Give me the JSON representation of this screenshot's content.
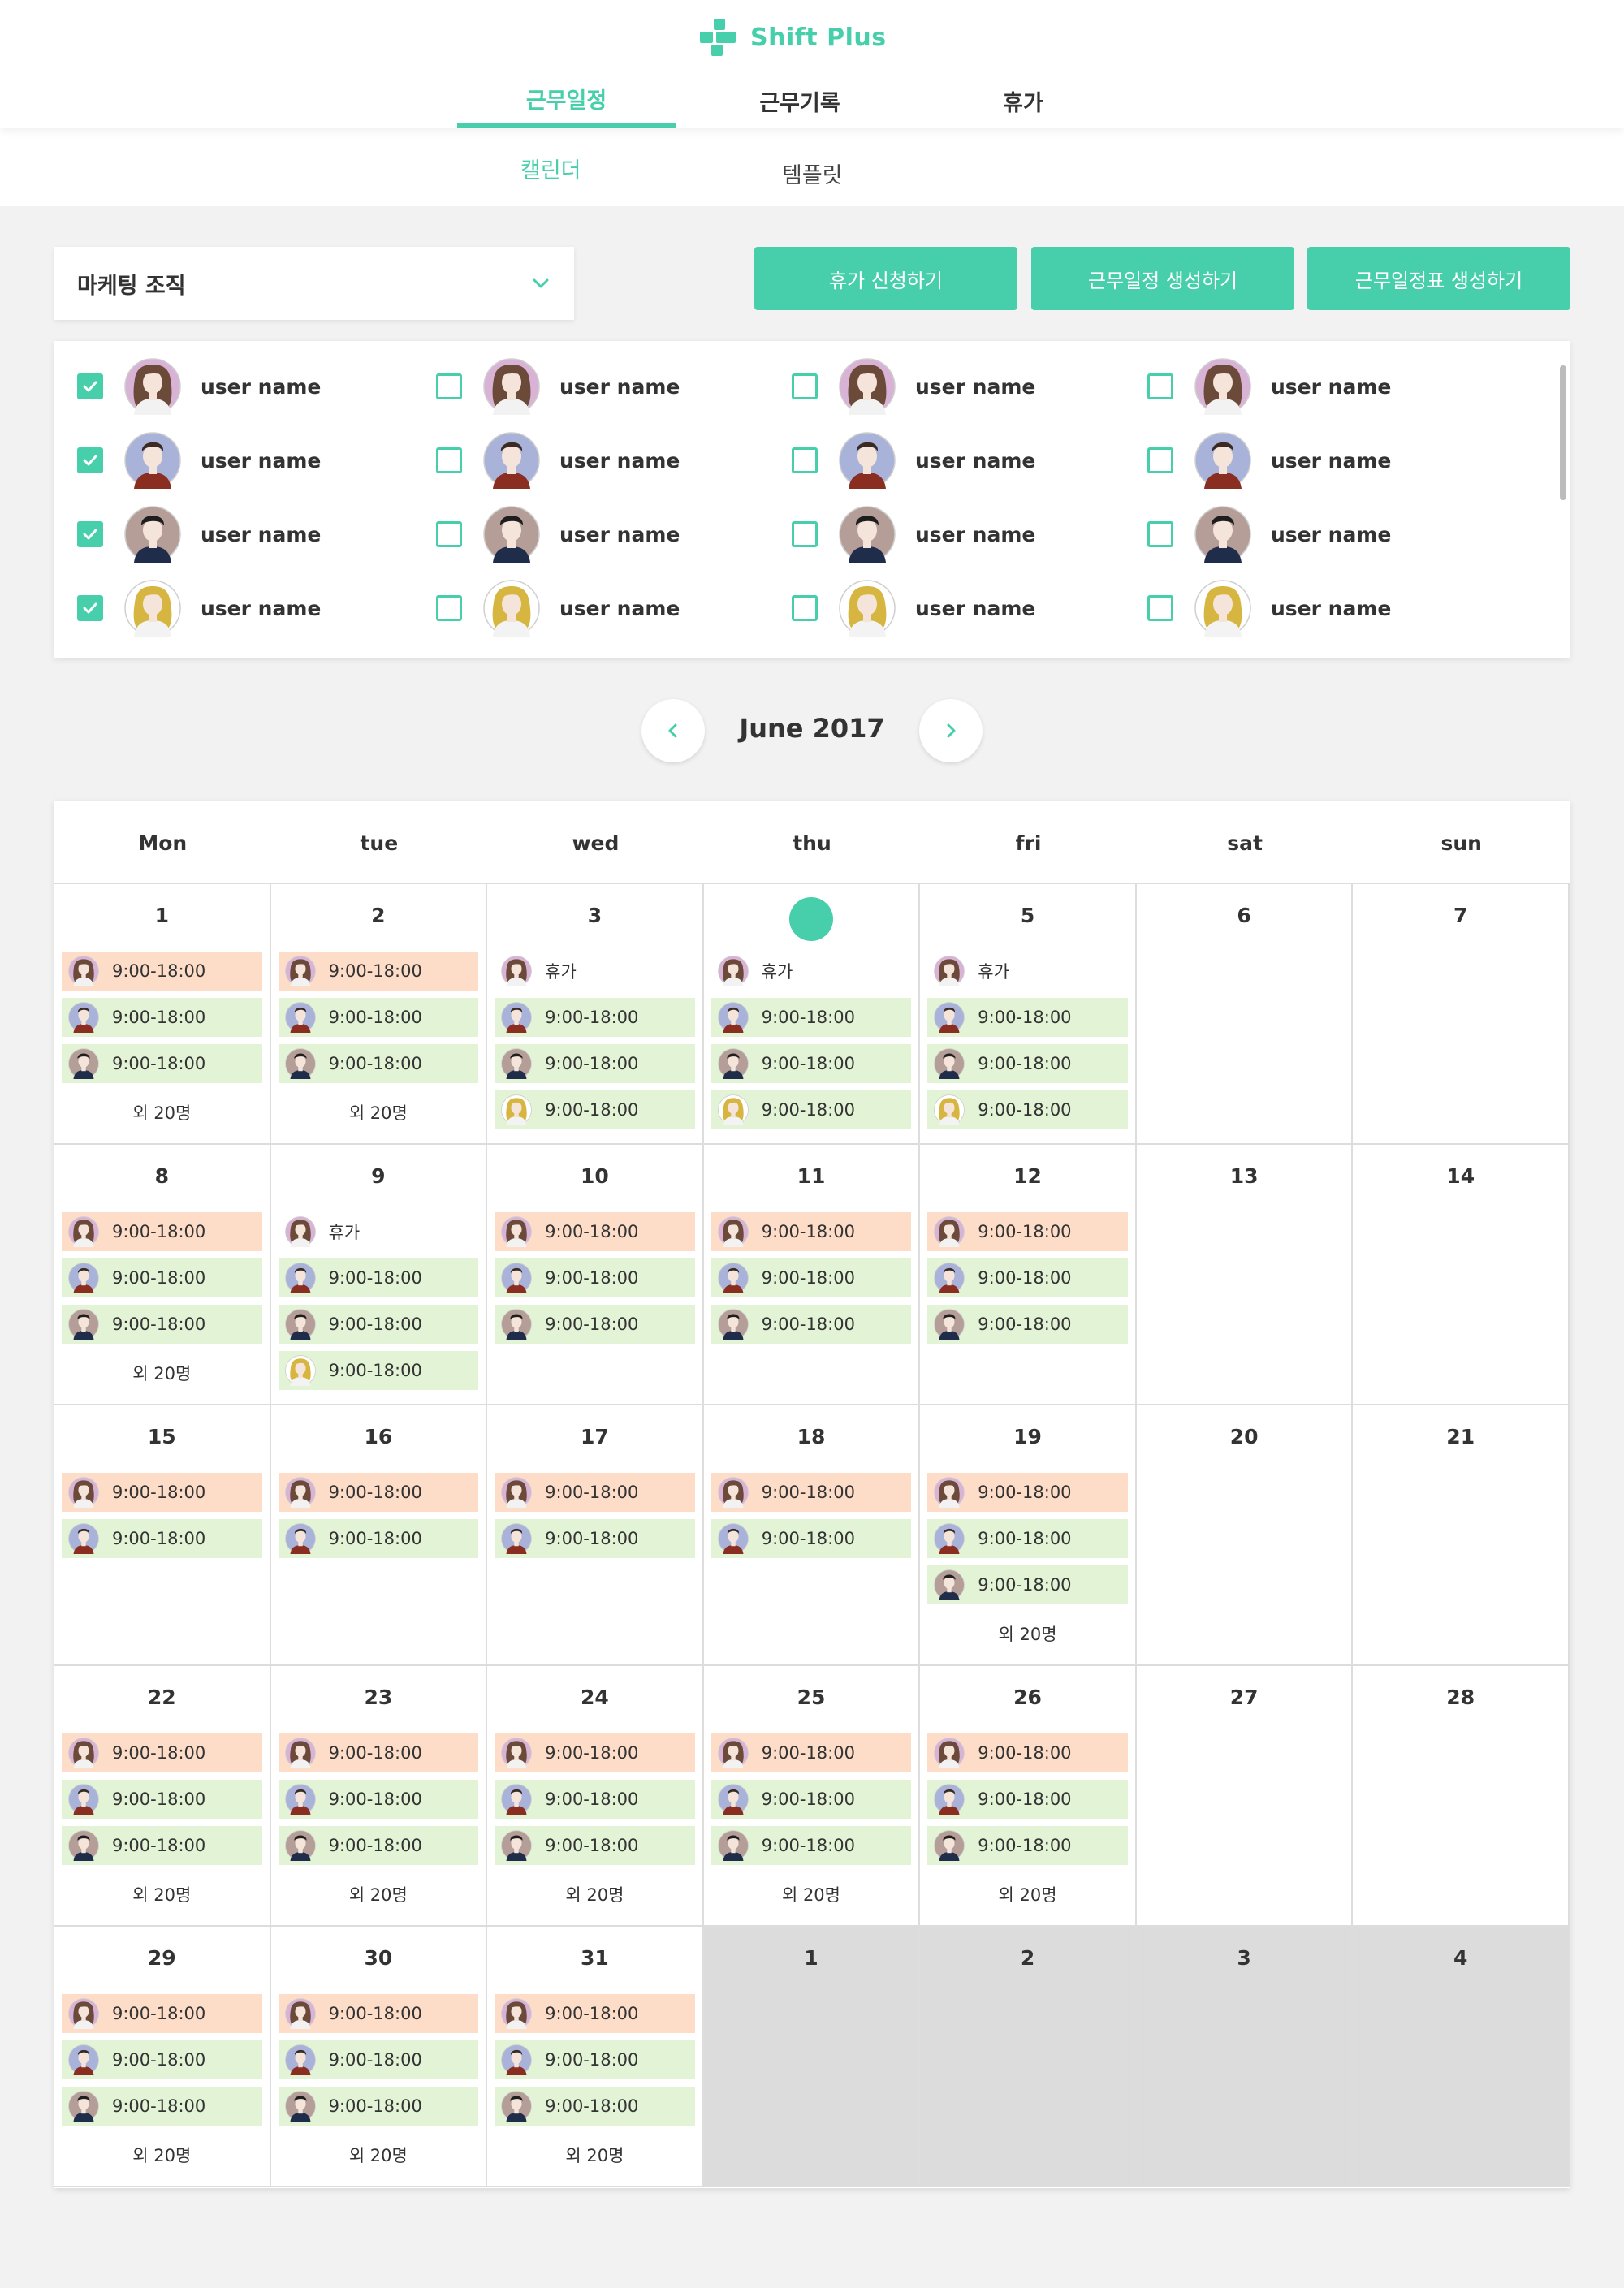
{
  "app": {
    "name": "Shift Plus",
    "accent": "#46cfaa"
  },
  "main_tabs": [
    {
      "label": "근무일정",
      "active": true
    },
    {
      "label": "근무기록",
      "active": false
    },
    {
      "label": "휴가",
      "active": false
    }
  ],
  "sub_tabs": [
    {
      "label": "캘린더",
      "active": true
    },
    {
      "label": "템플릿",
      "active": false
    }
  ],
  "org_select": {
    "value": "마케팅 조직",
    "icon": "chevron-down-icon"
  },
  "actions": [
    {
      "label": "휴가 신청하기"
    },
    {
      "label": "근무일정 생성하기"
    },
    {
      "label": "근무일정표 생성하기"
    }
  ],
  "users": [
    {
      "name": "user name",
      "checked": true,
      "avatar": "f1"
    },
    {
      "name": "user name",
      "checked": false,
      "avatar": "f1"
    },
    {
      "name": "user name",
      "checked": false,
      "avatar": "f1"
    },
    {
      "name": "user name",
      "checked": false,
      "avatar": "f1"
    },
    {
      "name": "user name",
      "checked": true,
      "avatar": "m1"
    },
    {
      "name": "user name",
      "checked": false,
      "avatar": "m1"
    },
    {
      "name": "user name",
      "checked": false,
      "avatar": "m1"
    },
    {
      "name": "user name",
      "checked": false,
      "avatar": "m1"
    },
    {
      "name": "user name",
      "checked": true,
      "avatar": "m2"
    },
    {
      "name": "user name",
      "checked": false,
      "avatar": "m2"
    },
    {
      "name": "user name",
      "checked": false,
      "avatar": "m2"
    },
    {
      "name": "user name",
      "checked": false,
      "avatar": "m2"
    },
    {
      "name": "user name",
      "checked": true,
      "avatar": "f2"
    },
    {
      "name": "user name",
      "checked": false,
      "avatar": "f2"
    },
    {
      "name": "user name",
      "checked": false,
      "avatar": "f2"
    },
    {
      "name": "user name",
      "checked": false,
      "avatar": "f2"
    }
  ],
  "calendar": {
    "month_title": "June 2017",
    "weekdays": [
      "Mon",
      "tue",
      "wed",
      "thu",
      "fri",
      "sat",
      "sun"
    ],
    "weeks": [
      [
        {
          "num": "1",
          "shifts": [
            [
              "f1",
              "9:00-18:00",
              "orange"
            ],
            [
              "m1",
              "9:00-18:00",
              "green"
            ],
            [
              "m2",
              "9:00-18:00",
              "green"
            ]
          ],
          "more": "외 20명"
        },
        {
          "num": "2",
          "shifts": [
            [
              "f1",
              "9:00-18:00",
              "orange"
            ],
            [
              "m1",
              "9:00-18:00",
              "green"
            ],
            [
              "m2",
              "9:00-18:00",
              "green"
            ]
          ],
          "more": "외 20명"
        },
        {
          "num": "3",
          "shifts": [
            [
              "f1",
              "휴가",
              "plain"
            ],
            [
              "m1",
              "9:00-18:00",
              "green"
            ],
            [
              "m2",
              "9:00-18:00",
              "green"
            ],
            [
              "f2",
              "9:00-18:00",
              "green"
            ]
          ]
        },
        {
          "num": "",
          "today": true,
          "shifts": [
            [
              "f1",
              "휴가",
              "plain"
            ],
            [
              "m1",
              "9:00-18:00",
              "green"
            ],
            [
              "m2",
              "9:00-18:00",
              "green"
            ],
            [
              "f2",
              "9:00-18:00",
              "green"
            ]
          ]
        },
        {
          "num": "5",
          "shifts": [
            [
              "f1",
              "휴가",
              "plain"
            ],
            [
              "m1",
              "9:00-18:00",
              "green"
            ],
            [
              "m2",
              "9:00-18:00",
              "green"
            ],
            [
              "f2",
              "9:00-18:00",
              "green"
            ]
          ]
        },
        {
          "num": "6",
          "shifts": []
        },
        {
          "num": "7",
          "shifts": []
        }
      ],
      [
        {
          "num": "8",
          "shifts": [
            [
              "f1",
              "9:00-18:00",
              "orange"
            ],
            [
              "m1",
              "9:00-18:00",
              "green"
            ],
            [
              "m2",
              "9:00-18:00",
              "green"
            ]
          ],
          "more": "외 20명"
        },
        {
          "num": "9",
          "shifts": [
            [
              "f1",
              "휴가",
              "plain"
            ],
            [
              "m1",
              "9:00-18:00",
              "green"
            ],
            [
              "m2",
              "9:00-18:00",
              "green"
            ],
            [
              "f2",
              "9:00-18:00",
              "green"
            ]
          ]
        },
        {
          "num": "10",
          "shifts": [
            [
              "f1",
              "9:00-18:00",
              "orange"
            ],
            [
              "m1",
              "9:00-18:00",
              "green"
            ],
            [
              "m2",
              "9:00-18:00",
              "green"
            ]
          ]
        },
        {
          "num": "11",
          "shifts": [
            [
              "f1",
              "9:00-18:00",
              "orange"
            ],
            [
              "m1",
              "9:00-18:00",
              "green"
            ],
            [
              "m2",
              "9:00-18:00",
              "green"
            ]
          ]
        },
        {
          "num": "12",
          "shifts": [
            [
              "f1",
              "9:00-18:00",
              "orange"
            ],
            [
              "m1",
              "9:00-18:00",
              "green"
            ],
            [
              "m2",
              "9:00-18:00",
              "green"
            ]
          ]
        },
        {
          "num": "13",
          "shifts": []
        },
        {
          "num": "14",
          "shifts": []
        }
      ],
      [
        {
          "num": "15",
          "shifts": [
            [
              "f1",
              "9:00-18:00",
              "orange"
            ],
            [
              "m1",
              "9:00-18:00",
              "green"
            ]
          ]
        },
        {
          "num": "16",
          "shifts": [
            [
              "f1",
              "9:00-18:00",
              "orange"
            ],
            [
              "m1",
              "9:00-18:00",
              "green"
            ]
          ]
        },
        {
          "num": "17",
          "shifts": [
            [
              "f1",
              "9:00-18:00",
              "orange"
            ],
            [
              "m1",
              "9:00-18:00",
              "green"
            ]
          ]
        },
        {
          "num": "18",
          "shifts": [
            [
              "f1",
              "9:00-18:00",
              "orange"
            ],
            [
              "m1",
              "9:00-18:00",
              "green"
            ]
          ]
        },
        {
          "num": "19",
          "shifts": [
            [
              "f1",
              "9:00-18:00",
              "orange"
            ],
            [
              "m1",
              "9:00-18:00",
              "green"
            ],
            [
              "m2",
              "9:00-18:00",
              "green"
            ]
          ],
          "more": "외 20명"
        },
        {
          "num": "20",
          "shifts": []
        },
        {
          "num": "21",
          "shifts": []
        }
      ],
      [
        {
          "num": "22",
          "shifts": [
            [
              "f1",
              "9:00-18:00",
              "orange"
            ],
            [
              "m1",
              "9:00-18:00",
              "green"
            ],
            [
              "m2",
              "9:00-18:00",
              "green"
            ]
          ],
          "more": "외 20명"
        },
        {
          "num": "23",
          "shifts": [
            [
              "f1",
              "9:00-18:00",
              "orange"
            ],
            [
              "m1",
              "9:00-18:00",
              "green"
            ],
            [
              "m2",
              "9:00-18:00",
              "green"
            ]
          ],
          "more": "외 20명"
        },
        {
          "num": "24",
          "shifts": [
            [
              "f1",
              "9:00-18:00",
              "orange"
            ],
            [
              "m1",
              "9:00-18:00",
              "green"
            ],
            [
              "m2",
              "9:00-18:00",
              "green"
            ]
          ],
          "more": "외 20명"
        },
        {
          "num": "25",
          "shifts": [
            [
              "f1",
              "9:00-18:00",
              "orange"
            ],
            [
              "m1",
              "9:00-18:00",
              "green"
            ],
            [
              "m2",
              "9:00-18:00",
              "green"
            ]
          ],
          "more": "외 20명"
        },
        {
          "num": "26",
          "shifts": [
            [
              "f1",
              "9:00-18:00",
              "orange"
            ],
            [
              "m1",
              "9:00-18:00",
              "green"
            ],
            [
              "m2",
              "9:00-18:00",
              "green"
            ]
          ],
          "more": "외 20명"
        },
        {
          "num": "27",
          "shifts": []
        },
        {
          "num": "28",
          "shifts": []
        }
      ],
      [
        {
          "num": "29",
          "shifts": [
            [
              "f1",
              "9:00-18:00",
              "orange"
            ],
            [
              "m1",
              "9:00-18:00",
              "green"
            ],
            [
              "m2",
              "9:00-18:00",
              "green"
            ]
          ],
          "more": "외 20명"
        },
        {
          "num": "30",
          "shifts": [
            [
              "f1",
              "9:00-18:00",
              "orange"
            ],
            [
              "m1",
              "9:00-18:00",
              "green"
            ],
            [
              "m2",
              "9:00-18:00",
              "green"
            ]
          ],
          "more": "외 20명"
        },
        {
          "num": "31",
          "shifts": [
            [
              "f1",
              "9:00-18:00",
              "orange"
            ],
            [
              "m1",
              "9:00-18:00",
              "green"
            ],
            [
              "m2",
              "9:00-18:00",
              "green"
            ]
          ],
          "more": "외 20명"
        },
        {
          "num": "1",
          "other": true,
          "shifts": []
        },
        {
          "num": "2",
          "other": true,
          "shifts": []
        },
        {
          "num": "3",
          "other": true,
          "shifts": []
        },
        {
          "num": "4",
          "other": true,
          "shifts": []
        }
      ]
    ]
  },
  "colors": {
    "accent": "#46cfaa",
    "shift_orange": "#fddcc8",
    "shift_green": "#e3f3d6",
    "other_month": "#dcdcdc",
    "background": "#f2f2f2"
  }
}
